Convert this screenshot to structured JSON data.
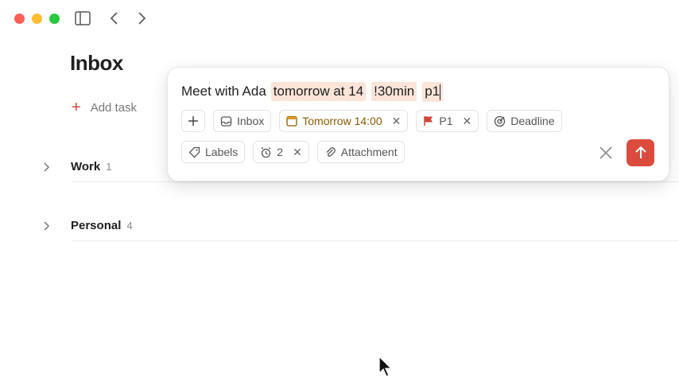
{
  "page": {
    "title": "Inbox",
    "add_task_label": "Add task"
  },
  "sections": [
    {
      "name": "Work",
      "count": "1"
    },
    {
      "name": "Personal",
      "count": "4"
    }
  ],
  "quick_add": {
    "task_text": "Meet with Ada",
    "tokens": [
      "tomorrow at 14",
      "!30min",
      "p1"
    ],
    "project": "Inbox",
    "date": "Tomorrow 14:00",
    "priority": "P1",
    "deadline": "Deadline",
    "labels": "Labels",
    "reminders": "2",
    "attachment": "Attachment"
  },
  "colors": {
    "accent": "#dc4c3e",
    "token_bg": "#fbe5d9",
    "date_text": "#8a5a00"
  }
}
